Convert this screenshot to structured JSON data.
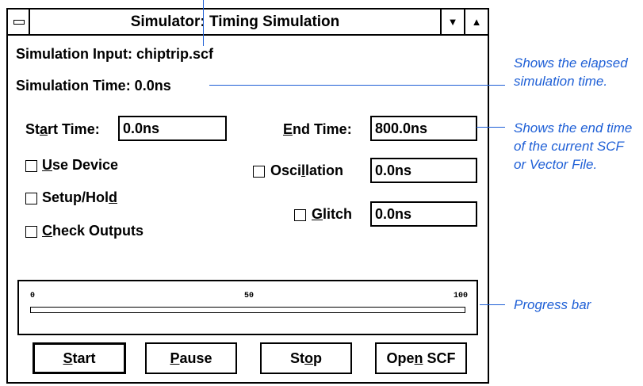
{
  "window": {
    "title": "Simulator: Timing Simulation",
    "sys_menu_icon": "system-menu-icon",
    "min_icon": "▼",
    "max_icon": "▲"
  },
  "info": {
    "input_label": "Simulation Input: chiptrip.scf",
    "time_label": "Simulation Time: 0.0ns"
  },
  "start_time": {
    "label_pre": "St",
    "label_u": "a",
    "label_post": "rt Time:",
    "value": "0.0ns"
  },
  "end_time": {
    "label_u": "E",
    "label_post": "nd Time:",
    "value": "800.0ns"
  },
  "options": {
    "use_device": {
      "u": "U",
      "post": "se Device",
      "checked": false
    },
    "setup_hold": {
      "pre": "Setup/Hol",
      "u": "d",
      "checked": false
    },
    "check_outputs": {
      "u": "C",
      "post": "heck Outputs",
      "checked": false
    },
    "oscillation": {
      "pre": "Osci",
      "u": "l",
      "post": "lation",
      "value": "0.0ns",
      "checked": false
    },
    "glitch": {
      "u": "G",
      "post": "litch",
      "value": "0.0ns",
      "checked": false
    }
  },
  "progress": {
    "ticks": [
      "0",
      "50",
      "100"
    ],
    "percent": 0
  },
  "buttons": {
    "start": {
      "u": "S",
      "post": "tart"
    },
    "pause": {
      "u": "P",
      "post": "ause"
    },
    "stop": {
      "pre": "St",
      "u": "o",
      "post": "p"
    },
    "open_scf": {
      "pre": "Ope",
      "u": "n",
      "post": " SCF"
    }
  },
  "annotations": {
    "elapsed": [
      "Shows the elapsed",
      "simulation time."
    ],
    "end_time": [
      "Shows the end time",
      "of the current SCF",
      "or Vector File."
    ],
    "progress": "Progress bar"
  },
  "colors": {
    "annotation": "#1e5fd6",
    "progress_fill": "#0000ff"
  }
}
